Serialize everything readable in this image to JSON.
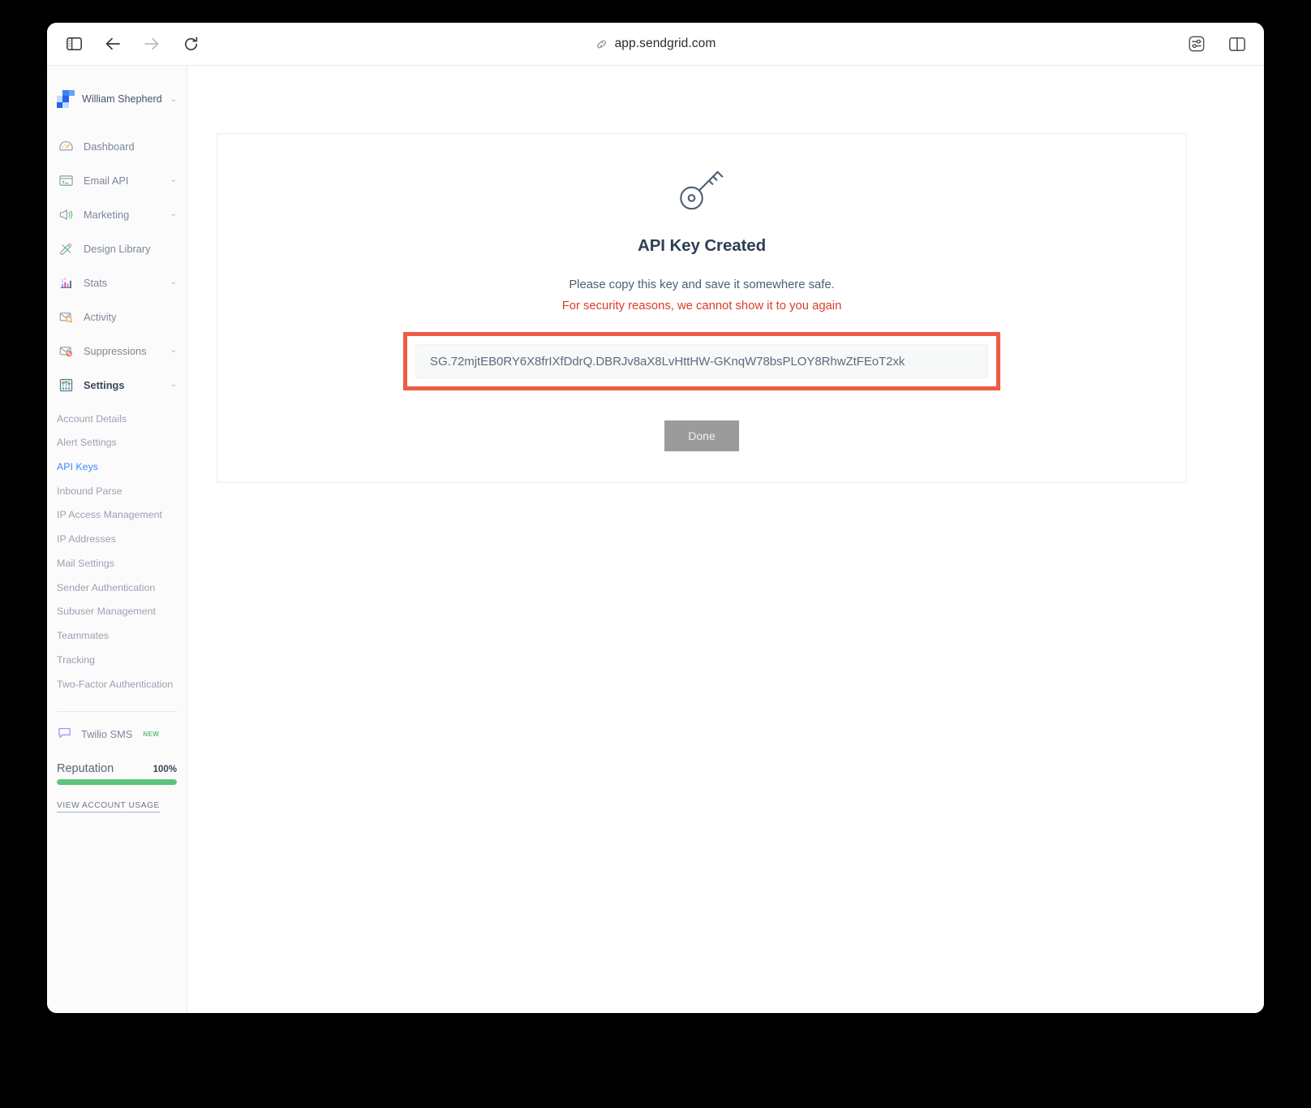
{
  "browser": {
    "url": "app.sendgrid.com",
    "toolbar": {
      "sidebar_toggle": "sidebar-toggle",
      "back": "back",
      "forward": "forward",
      "reload": "reload",
      "settings": "settings",
      "split_view": "split-view"
    }
  },
  "sidebar": {
    "account_name": "William Shepherd",
    "nav": [
      {
        "label": "Dashboard",
        "icon": "gauge-icon",
        "expandable": false,
        "active": false
      },
      {
        "label": "Email API",
        "icon": "code-window-icon",
        "expandable": true,
        "active": false
      },
      {
        "label": "Marketing",
        "icon": "megaphone-icon",
        "expandable": true,
        "active": false
      },
      {
        "label": "Design Library",
        "icon": "pencil-ruler-icon",
        "expandable": false,
        "active": false
      },
      {
        "label": "Stats",
        "icon": "bar-chart-icon",
        "expandable": true,
        "active": false
      },
      {
        "label": "Activity",
        "icon": "envelope-search-icon",
        "expandable": false,
        "active": false
      },
      {
        "label": "Suppressions",
        "icon": "envelope-block-icon",
        "expandable": true,
        "active": false
      },
      {
        "label": "Settings",
        "icon": "sliders-box-icon",
        "expandable": true,
        "active": true
      }
    ],
    "settings_submenu": [
      {
        "label": "Account Details",
        "active": false
      },
      {
        "label": "Alert Settings",
        "active": false
      },
      {
        "label": "API Keys",
        "active": true
      },
      {
        "label": "Inbound Parse",
        "active": false
      },
      {
        "label": "IP Access Management",
        "active": false
      },
      {
        "label": "IP Addresses",
        "active": false
      },
      {
        "label": "Mail Settings",
        "active": false
      },
      {
        "label": "Sender Authentication",
        "active": false
      },
      {
        "label": "Subuser Management",
        "active": false
      },
      {
        "label": "Teammates",
        "active": false
      },
      {
        "label": "Tracking",
        "active": false
      },
      {
        "label": "Two-Factor Authentication",
        "active": false
      }
    ],
    "twilio": {
      "label": "Twilio SMS",
      "badge": "NEW"
    },
    "reputation": {
      "title": "Reputation",
      "value": "100%",
      "percent": 100,
      "bar_color": "#5cc47c"
    },
    "view_usage": "VIEW ACCOUNT USAGE"
  },
  "main": {
    "title": "API Key Created",
    "subtitle": "Please copy this key and save it somewhere safe.",
    "warning": "For security reasons, we cannot show it to you again",
    "api_key": "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",
    "done_label": "Done",
    "highlight_color": "#ef5b45",
    "warning_color": "#dc3a2c"
  }
}
